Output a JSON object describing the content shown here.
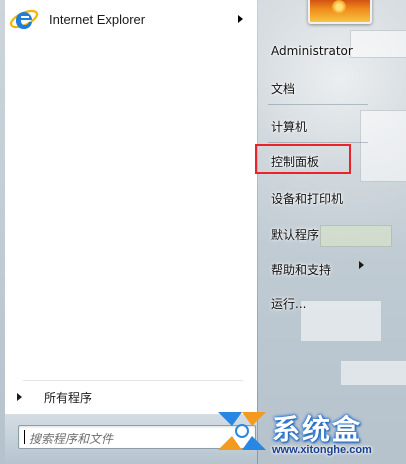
{
  "left": {
    "pinned": [
      {
        "label": "Internet Explorer",
        "icon": "internet-explorer-icon"
      }
    ],
    "all_programs_label": "所有程序",
    "search_placeholder": "搜索程序和文件"
  },
  "right": {
    "items": [
      {
        "label": "Administrator"
      },
      {
        "label": "文档"
      },
      {
        "label": "计算机"
      },
      {
        "label": "控制面板"
      },
      {
        "label": "设备和打印机"
      },
      {
        "label": "默认程序"
      },
      {
        "label": "帮助和支持"
      },
      {
        "label": "运行..."
      }
    ],
    "highlighted_item": "控制面板"
  },
  "watermark": {
    "name": "系统盒",
    "url": "www.xitonghe.com"
  },
  "colors": {
    "highlight_border": "#e8232a",
    "ie_blue": "#1f7fd8",
    "ie_gold": "#f4b400",
    "watermark_blue": "#1f6fd1"
  }
}
